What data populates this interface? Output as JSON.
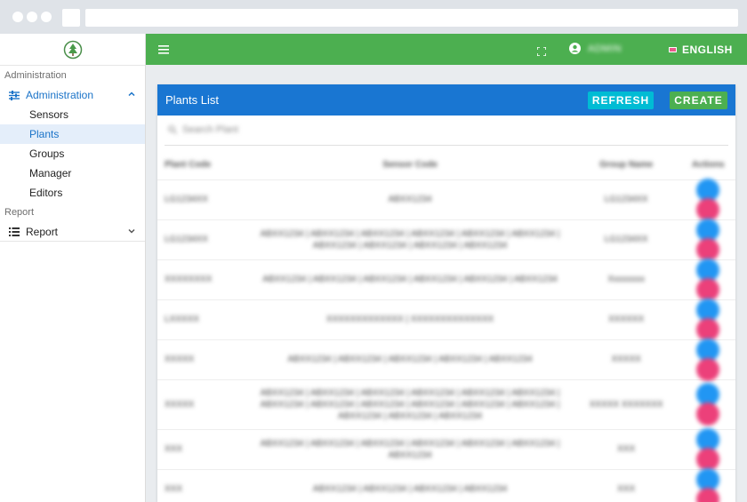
{
  "sidebar": {
    "sections": [
      {
        "label": "Administration"
      },
      {
        "label": "Report"
      }
    ],
    "admin_parent": "Administration",
    "admin_items": [
      "Sensors",
      "Plants",
      "Groups",
      "Manager",
      "Editors"
    ],
    "report_parent": "Report"
  },
  "topbar": {
    "user_name": "ADMIN",
    "language": "ENGLISH"
  },
  "main": {
    "title": "Plants List",
    "refresh_label": "REFRESH",
    "create_label": "CREATE",
    "search_placeholder": "Search Plant",
    "columns": [
      "Plant Code",
      "Sensor Code",
      "Group Name",
      "Actions"
    ],
    "rows": [
      {
        "code": "LG1234XX",
        "sensors": "ABXX1234",
        "group": "LG1234XX"
      },
      {
        "code": "LG1234XX",
        "sensors": "ABXX1234 | ABXX1234 | ABXX1234 | ABXX1234 | ABXX1234 | ABXX1234 | ABXX1234 | ABXX1234 | ABXX1234 | ABXX1234",
        "group": "LG1234XX"
      },
      {
        "code": "XXXXXXXX",
        "sensors": "ABXX1234 | ABXX1234 | ABXX1234 | ABXX1234 | ABXX1234 | ABXX1234",
        "group": "Xxxxxxxx"
      },
      {
        "code": "LXXXXX",
        "sensors": "XXXXXXXXXXXXX | XXXXXXXXXXXXXX",
        "group": "XXXXXX"
      },
      {
        "code": "XXXXX",
        "sensors": "ABXX1234 | ABXX1234 | ABXX1234 | ABXX1234 | ABXX1234",
        "group": "XXXXX"
      },
      {
        "code": "XXXXX",
        "sensors": "ABXX1234 | ABXX1234 | ABXX1234 | ABXX1234 | ABXX1234 | ABXX1234 | ABXX1234 | ABXX1234 | ABXX1234 | ABXX1234 | ABXX1234 | ABXX1234 | ABXX1234 | ABXX1234 | ABXX1234",
        "group": "XXXXX XXXXXXX"
      },
      {
        "code": "XXX",
        "sensors": "ABXX1234 | ABXX1234 | ABXX1234 | ABXX1234 | ABXX1234 | ABXX1234 | ABXX1234",
        "group": "XXX"
      },
      {
        "code": "XXX",
        "sensors": "ABXX1234 | ABXX1234 | ABXX1234 | ABXX1234",
        "group": "XXX"
      }
    ]
  },
  "colors": {
    "topbar": "#4caf50",
    "card_header": "#1976d2",
    "refresh": "#00bcd4",
    "create": "#4caf50",
    "edit": "#2196f3",
    "delete": "#ec407a",
    "active_nav": "#1a73c8"
  },
  "icons": {
    "menu": "hamburger-icon",
    "fullscreen": "fullscreen-icon",
    "user": "account-circle-icon",
    "admin": "tune-icon",
    "report": "list-icon"
  }
}
